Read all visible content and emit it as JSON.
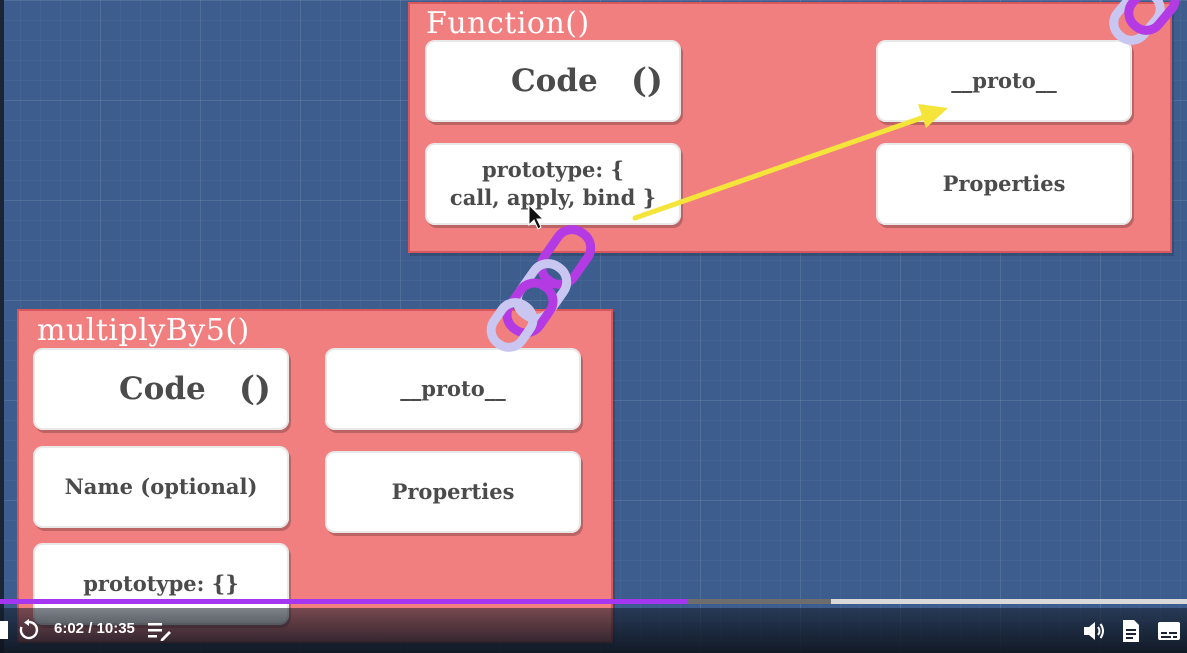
{
  "slide": {
    "function_panel": {
      "title": "Function()",
      "code_label": "Code",
      "code_parens": "()",
      "prototype_line1": "prototype: {",
      "prototype_line2": "call, apply, bind }",
      "proto_label": "__proto__",
      "properties_label": "Properties"
    },
    "multiply_panel": {
      "title": "multiplyBy5()",
      "code_label": "Code",
      "code_parens": "()",
      "name_label": "Name (optional)",
      "prototype_label": "prototype: {}",
      "proto_label": "__proto__",
      "properties_label": "Properties"
    }
  },
  "player": {
    "time_display": "6:02 / 10:35",
    "progress_fraction": 0.58,
    "buffered_fraction": 0.7,
    "icons": {
      "replay": "rewind-5-icon",
      "notes": "notes-icon",
      "volume": "volume-icon",
      "transcript": "transcript-icon",
      "captions": "captions-icon"
    },
    "colors": {
      "progress": "#a435f0",
      "accent_arrow": "#f5e53a"
    }
  }
}
